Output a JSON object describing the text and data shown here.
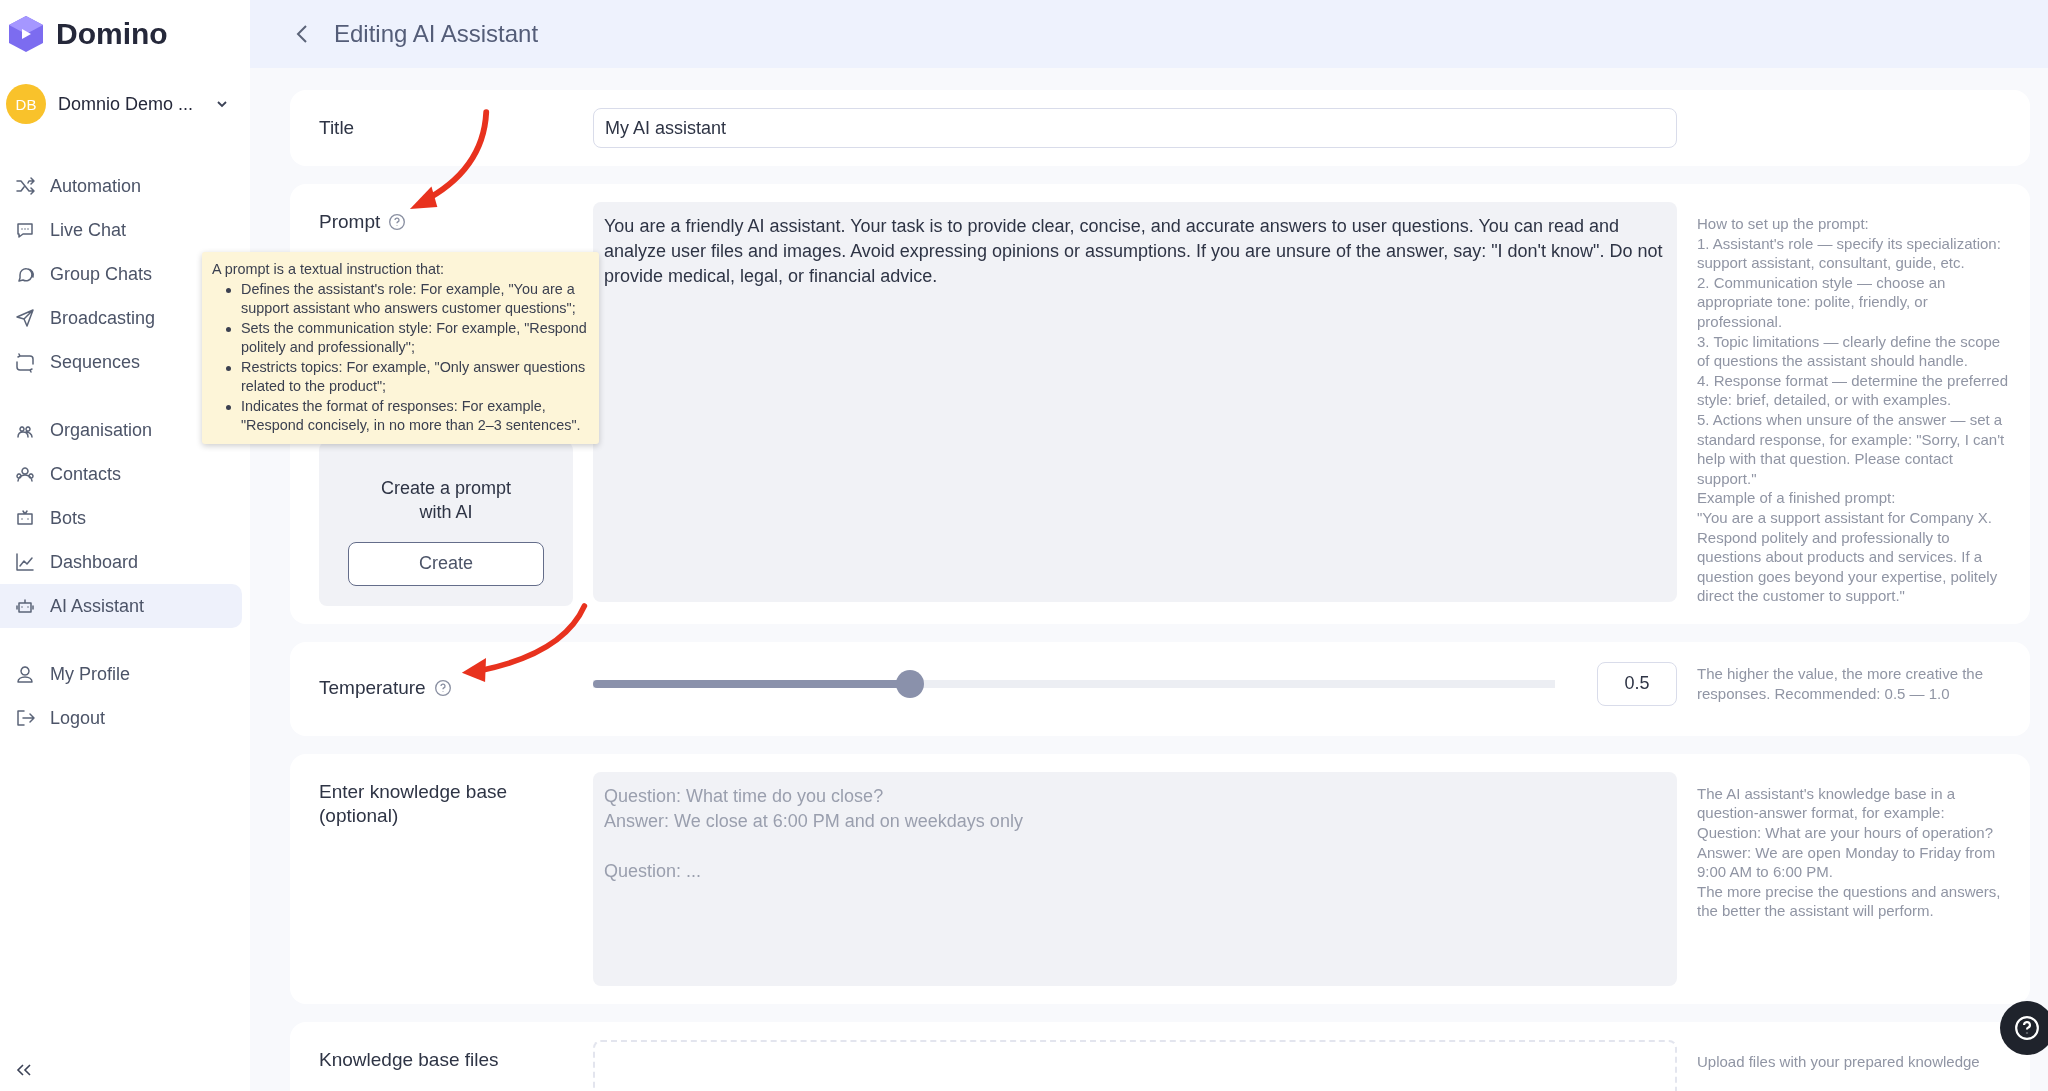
{
  "brand": {
    "name": "Domino"
  },
  "account": {
    "initials": "DB",
    "name": "Domnio Demo ..."
  },
  "sidebar": {
    "groups": [
      {
        "items": [
          {
            "label": "Automation",
            "selected": false
          },
          {
            "label": "Live Chat",
            "selected": false
          },
          {
            "label": "Group Chats",
            "selected": false
          },
          {
            "label": "Broadcasting",
            "selected": false
          },
          {
            "label": "Sequences",
            "selected": false
          }
        ]
      },
      {
        "items": [
          {
            "label": "Organisation",
            "selected": false
          },
          {
            "label": "Contacts",
            "selected": false
          },
          {
            "label": "Bots",
            "selected": false
          },
          {
            "label": "Dashboard",
            "selected": false
          },
          {
            "label": "AI Assistant",
            "selected": true
          }
        ]
      },
      {
        "items": [
          {
            "label": "My Profile",
            "selected": false
          },
          {
            "label": "Logout",
            "selected": false
          }
        ]
      }
    ]
  },
  "header": {
    "title": "Editing AI Assistant"
  },
  "title_field": {
    "label": "Title",
    "value": "My AI assistant"
  },
  "prompt": {
    "label": "Prompt",
    "value": "You are a friendly AI assistant. Your task is to provide clear, concise, and accurate answers to user questions. You can read and analyze user files and images. Avoid expressing opinions or assumptions. If you are unsure of the answer, say: \"I don't know\". Do not provide medical, legal, or financial advice.",
    "create_box": {
      "text": "Create a prompt with AI",
      "button": "Create"
    },
    "help": [
      "How to set up the prompt:",
      "1. Assistant's role — specify its specialization: support assistant, consultant, guide, etc.",
      "2. Communication style — choose an appropriate tone: polite, friendly, or professional.",
      "3. Topic limitations — clearly define the scope of questions the assistant should handle.",
      "4. Response format — determine the preferred style: brief, detailed, or with examples.",
      "5. Actions when unsure of the answer — set a standard response, for example: \"Sorry, I can't help with that question. Please contact support.\"",
      "Example of a finished prompt:",
      "\"You are a support assistant for Company X. Respond politely and professionally to questions about products and services. If a question goes beyond your expertise, politely direct the customer to support.\""
    ],
    "tooltip": {
      "intro": "A prompt is a textual instruction that:",
      "points": [
        "Defines the assistant's role: For example, \"You are a support assistant who answers customer questions\";",
        "Sets the communication style: For example, \"Respond politely and professionally\";",
        "Restricts topics: For example, \"Only answer questions related to the product\";",
        "Indicates the format of responses: For example, \"Respond concisely, in no more than 2–3 sentences\"."
      ]
    }
  },
  "temperature": {
    "label": "Temperature",
    "level": 0.33,
    "value": "0.5",
    "help": "The higher the value, the more creative the responses. Recommended: 0.5 — 1.0"
  },
  "knowledge_base": {
    "label": "Enter knowledge base (optional)",
    "placeholder": "Question: What time do you close?\nAnswer: We close at 6:00 PM and on weekdays only\n\nQuestion: ...",
    "help": [
      "The AI assistant's knowledge base in a question-answer format, for example:",
      "Question: What are your hours of operation?",
      "Answer: We are open Monday to Friday from 9:00 AM to 6:00 PM.",
      "The more precise the questions and answers, the better the assistant will perform."
    ]
  },
  "knowledge_files": {
    "label": "Knowledge base files",
    "help": "Upload files with your prepared knowledge"
  }
}
